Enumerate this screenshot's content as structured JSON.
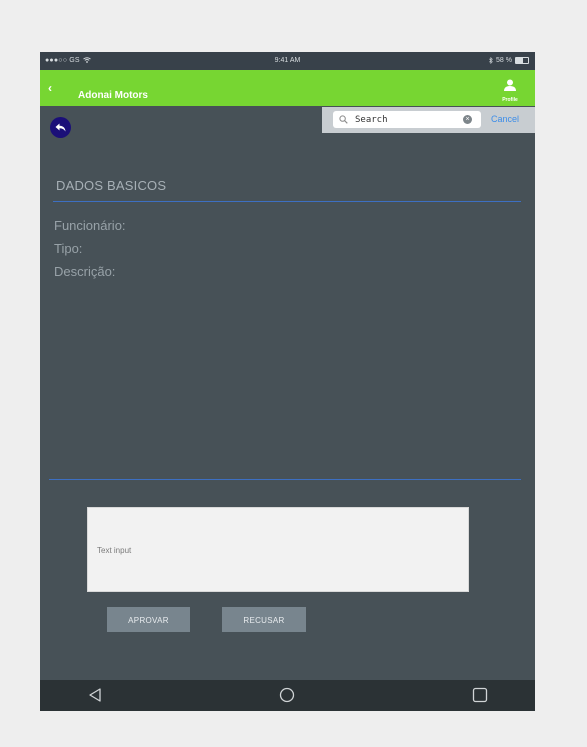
{
  "status_bar": {
    "carrier": "●●●○○ GS",
    "time": "9:41 AM",
    "battery": "58 %"
  },
  "app_bar": {
    "title": "Adonai Motors",
    "profile_label": "Profile",
    "background": "#77d632"
  },
  "search": {
    "placeholder": "Search",
    "cancel_label": "Cancel"
  },
  "form": {
    "section_title": "DADOS BASICOS",
    "fields": [
      {
        "label": "Funcionário:"
      },
      {
        "label": "Tipo:"
      },
      {
        "label": "Descrição:"
      }
    ],
    "text_input_placeholder": "Text input"
  },
  "actions": {
    "approve_label": "APROVAR",
    "reject_label": "RECUSAR"
  },
  "icons": {
    "back_fab": "reply-arrow-icon",
    "app_back": "chevron-left-icon",
    "profile": "person-icon",
    "search": "search-icon",
    "clear": "clear-circle-icon",
    "nav_back": "triangle-back-icon",
    "nav_home": "circle-home-icon",
    "nav_recents": "square-recents-icon"
  },
  "colors": {
    "app_bar": "#77d632",
    "background": "#475157",
    "accent_line": "#3d6fc2",
    "fab": "#1b0f78",
    "button": "#78858e"
  }
}
